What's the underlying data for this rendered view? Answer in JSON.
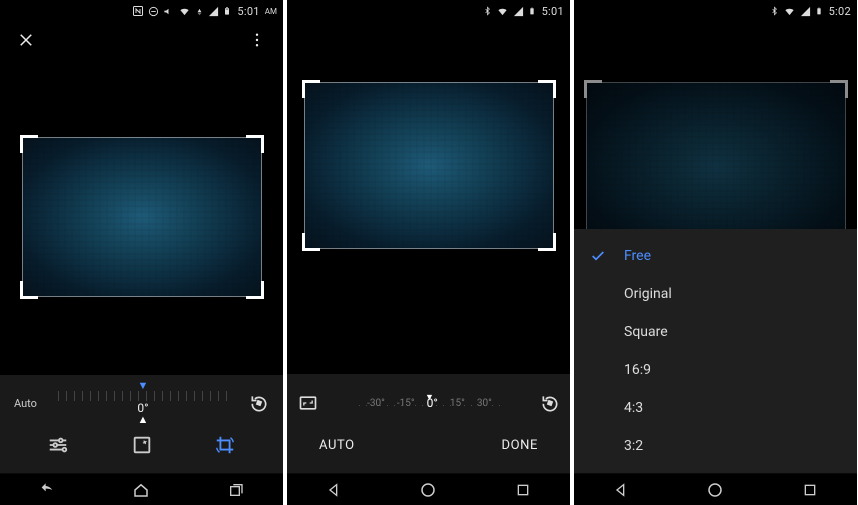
{
  "panels": {
    "p1": {
      "statusbar": {
        "time": "5:01",
        "ampm": "AM",
        "icons": [
          "nfc",
          "dnd",
          "volume",
          "wifi",
          "data",
          "signal",
          "battery"
        ]
      },
      "topbar": {
        "close": "close",
        "more": "more"
      },
      "crop": {
        "angle_value": "0°"
      },
      "auto_label": "Auto",
      "modes": {
        "tune": "tune",
        "filters": "filters",
        "crop": "crop",
        "active": "crop"
      }
    },
    "p2": {
      "statusbar": {
        "time": "5:01",
        "icons": [
          "bluetooth",
          "wifi",
          "data",
          "battery"
        ]
      },
      "angle_marks": {
        "m30n": "-30°",
        "m15n": "-15°",
        "zero": "0°",
        "m15p": "15°",
        "m30p": "30°"
      },
      "buttons": {
        "auto": "AUTO",
        "done": "DONE"
      }
    },
    "p3": {
      "statusbar": {
        "time": "5:02",
        "icons": [
          "bluetooth",
          "wifi",
          "data",
          "battery"
        ]
      },
      "aspect_options": [
        {
          "label": "Free",
          "selected": true
        },
        {
          "label": "Original",
          "selected": false
        },
        {
          "label": "Square",
          "selected": false
        },
        {
          "label": "16:9",
          "selected": false
        },
        {
          "label": "4:3",
          "selected": false
        },
        {
          "label": "3:2",
          "selected": false
        }
      ]
    }
  },
  "colors": {
    "accent": "#4c8dff"
  }
}
